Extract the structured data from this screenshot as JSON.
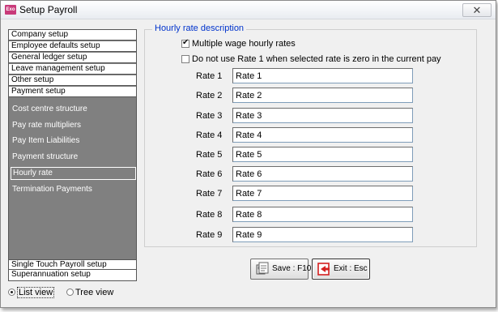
{
  "window": {
    "title": "Setup Payroll",
    "app_icon_text": "Exo",
    "close_glyph": "✕"
  },
  "left_panel": {
    "top_groups": [
      "Company setup",
      "Employee defaults setup",
      "General ledger setup",
      "Leave management setup",
      "Other setup",
      "Payment setup"
    ],
    "sub_items": [
      "Cost centre structure",
      "Pay rate multipliers",
      "Pay Item Liabilities",
      "Payment structure",
      "Hourly rate",
      "Termination Payments"
    ],
    "selected_sub_item": "Hourly rate",
    "bottom_groups": [
      "Single Touch Payroll setup",
      "Superannuation setup"
    ]
  },
  "view_toggle": {
    "list_view": "List view",
    "tree_view": "Tree view",
    "selected": "List view"
  },
  "hourly": {
    "legend": "Hourly rate description",
    "multiple_rates_label": "Multiple wage hourly rates",
    "multiple_rates_checked": true,
    "no_rate1_label": "Do not use Rate 1 when selected rate is zero in the current pay",
    "no_rate1_checked": false,
    "rates": [
      {
        "label": "Rate 1",
        "value": "Rate 1"
      },
      {
        "label": "Rate 2",
        "value": "Rate 2"
      },
      {
        "label": "Rate 3",
        "value": "Rate 3"
      },
      {
        "label": "Rate 4",
        "value": "Rate 4"
      },
      {
        "label": "Rate 5",
        "value": "Rate 5"
      },
      {
        "label": "Rate 6",
        "value": "Rate 6"
      },
      {
        "label": "Rate 7",
        "value": "Rate 7"
      },
      {
        "label": "Rate 8",
        "value": "Rate 8"
      },
      {
        "label": "Rate 9",
        "value": "Rate 9"
      }
    ]
  },
  "buttons": {
    "save": {
      "label": "Save : F10",
      "icon": "save-icon"
    },
    "exit": {
      "label": "Exit : Esc",
      "icon": "exit-icon"
    }
  },
  "colors": {
    "accent": "#0033cc",
    "panel_gray": "#808080",
    "exit_red": "#d42020"
  }
}
